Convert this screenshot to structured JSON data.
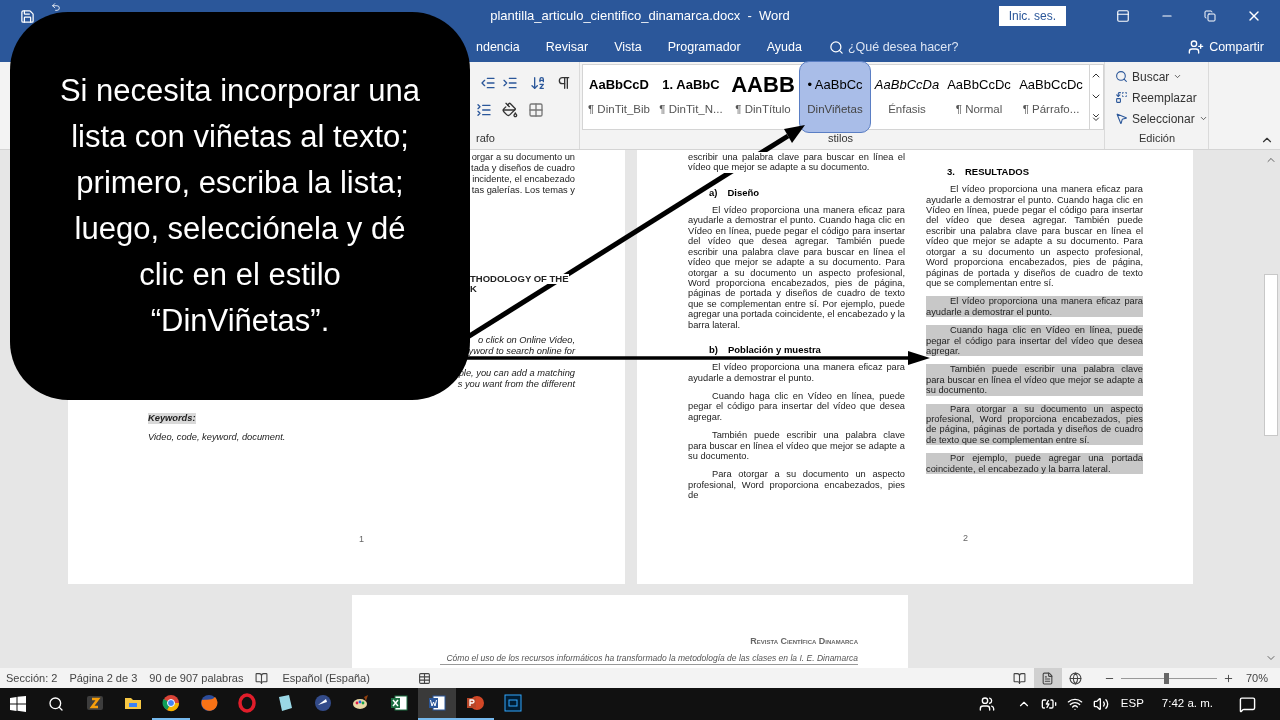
{
  "window": {
    "title": "plantilla_articulo_cientifico_dinamarca.docx  -  Word",
    "sign_in": "Inic. ses."
  },
  "tabs": [
    "ndencia",
    "Revisar",
    "Vista",
    "Programador",
    "Ayuda"
  ],
  "tell_me": {
    "placeholder": "¿Qué desea hacer?"
  },
  "share": "Compartir",
  "ribbon": {
    "paragraph_label": "rafo",
    "styles": [
      {
        "preview": "AaBbCcD",
        "name": "¶ DinTit_Bib",
        "kind": "bold",
        "selected": false
      },
      {
        "preview": "1.  AaBbC",
        "name": "¶ DinTit_N...",
        "kind": "bold",
        "selected": false
      },
      {
        "preview": "AABB",
        "name": "¶ DinTítulo",
        "kind": "large",
        "selected": false
      },
      {
        "preview": "• AaBbCc",
        "name": "DinViñetas",
        "kind": "plain",
        "selected": true
      },
      {
        "preview": "AaBbCcDa",
        "name": "Énfasis",
        "kind": "italic",
        "selected": false
      },
      {
        "preview": "AaBbCcDc",
        "name": "¶ Normal",
        "kind": "plain",
        "selected": false
      },
      {
        "preview": "AaBbCcDc",
        "name": "¶ Párrafo...",
        "kind": "plain",
        "selected": false
      }
    ],
    "styles_label": "stilos",
    "editing": [
      {
        "label": "Buscar",
        "caret": true
      },
      {
        "label": "Reemplazar",
        "caret": false
      },
      {
        "label": "Seleccionar",
        "caret": true
      }
    ],
    "editing_label": "Edición"
  },
  "callout": "Si necesita incorporar una lista con viñetas al texto; primero, escriba la lista; luego, selecciónela y dé clic en el estilo “DinViñetas”.",
  "page1": {
    "top_fragments": [
      "orgar a su documento un",
      "tada y diseños de cuadro",
      "incidente, el encabezado",
      "tas galerías. Los temas y"
    ],
    "heading_fragments": [
      "THODOLOGY OF THE",
      "K"
    ],
    "abstract_fragments": [
      "o click on Online Video,",
      "yword to search online for",
      "ple, you can add a matching",
      "s you want from the different"
    ],
    "keywords_label": "Keywords:",
    "keywords": "Video, code, keyword, document.",
    "page_number": "1"
  },
  "page2": {
    "columns": [
      [
        {
          "kind": "continuation",
          "text": "escribir una palabra clave para buscar en línea el vídeo que mejor se adapte a su documento.",
          "highlighted": false
        },
        {
          "kind": "heading",
          "number": "a)",
          "text": "Diseño"
        },
        {
          "kind": "para",
          "text": "El vídeo proporciona una manera eficaz para ayudarle a demostrar el punto. Cuando haga clic en Vídeo en línea, puede pegar el código para insertar del vídeo que desea agregar. También puede escribir una palabra clave para buscar en línea el vídeo que mejor se adapte a su documento. Para otorgar a su documento un aspecto profesional, Word proporciona encabezados, pies de página, páginas de portada y diseños de cuadro de texto que se complementan entre sí. Por ejemplo, puede agregar una portada coincidente, el encabezado y la barra lateral.",
          "highlighted": false
        },
        {
          "kind": "heading",
          "number": "b)",
          "text": "Población y muestra"
        },
        {
          "kind": "para",
          "text": "El vídeo proporciona una manera eficaz para ayudarle a demostrar el punto.",
          "highlighted": false
        },
        {
          "kind": "para",
          "text": "Cuando haga clic en Vídeo en línea, puede pegar el código para insertar del vídeo que desea agregar.",
          "highlighted": false
        },
        {
          "kind": "para",
          "text": "También puede escribir una palabra clave para buscar en línea el vídeo que mejor se adapte a su documento.",
          "highlighted": false
        },
        {
          "kind": "para",
          "text": "Para otorgar a su documento un aspecto profesional, Word proporciona encabezados, pies de",
          "highlighted": false
        }
      ],
      [
        {
          "kind": "heading",
          "number": "3.",
          "text": "RESULTADOS"
        },
        {
          "kind": "para",
          "text": "El vídeo proporciona una manera eficaz para ayudarle a demostrar el punto. Cuando haga clic en Vídeo en línea, puede pegar el código para insertar del vídeo que desea agregar. También puede escribir una palabra clave para buscar en línea el vídeo que mejor se adapte a su documento. Para otorgar a su documento un aspecto profesional, Word proporciona encabezados, pies de página, páginas de portada y diseños de cuadro de texto que se complementan entre sí.",
          "highlighted": false
        },
        {
          "kind": "para",
          "text": "El vídeo proporciona una manera eficaz para ayudarle a demostrar el punto.",
          "highlighted": true
        },
        {
          "kind": "para",
          "text": "Cuando haga clic en Vídeo en línea, puede pegar el código para insertar del vídeo que desea agregar.",
          "highlighted": true
        },
        {
          "kind": "para",
          "text": "También puede escribir una palabra clave para buscar en línea el vídeo que mejor se adapte a su documento.",
          "highlighted": true
        },
        {
          "kind": "para",
          "text": "Para otorgar a su documento un aspecto profesional, Word proporciona encabezados, pies de página, páginas de portada y diseños de cuadro de texto que se complementan entre sí.",
          "highlighted": true
        },
        {
          "kind": "para",
          "text": "Por ejemplo, puede agregar una portada coincidente, el encabezado y la barra lateral.",
          "highlighted": true
        }
      ]
    ],
    "page_number": "2"
  },
  "page3": {
    "journal": "Revista Científica Dinamarca",
    "subtitle": "Cómo el uso de los recursos informáticos ha transformado la metodología de las clases en la I. E. Dinamarca"
  },
  "status_bar": {
    "items": [
      "Sección: 2",
      "Página 2 de 3",
      "90 de 907 palabras"
    ],
    "language": "Español (España)",
    "views": [
      {
        "selected": false
      },
      {
        "selected": true
      },
      {
        "selected": false
      }
    ],
    "zoom": {
      "level": 0.45,
      "reading": "70%"
    }
  },
  "taskbar": {
    "apps": [
      {
        "running": false,
        "selected": false
      },
      {
        "running": false,
        "selected": false
      },
      {
        "running": true,
        "selected": false
      },
      {
        "running": false,
        "selected": false
      },
      {
        "running": false,
        "selected": false
      },
      {
        "running": false,
        "selected": false
      },
      {
        "running": false,
        "selected": false
      },
      {
        "running": false,
        "selected": false
      },
      {
        "running": false,
        "selected": false
      },
      {
        "running": true,
        "selected": true
      },
      {
        "running": true,
        "selected": false
      },
      {
        "running": false,
        "selected": false
      }
    ],
    "language": "ESP",
    "time": "7:42 a. m."
  }
}
